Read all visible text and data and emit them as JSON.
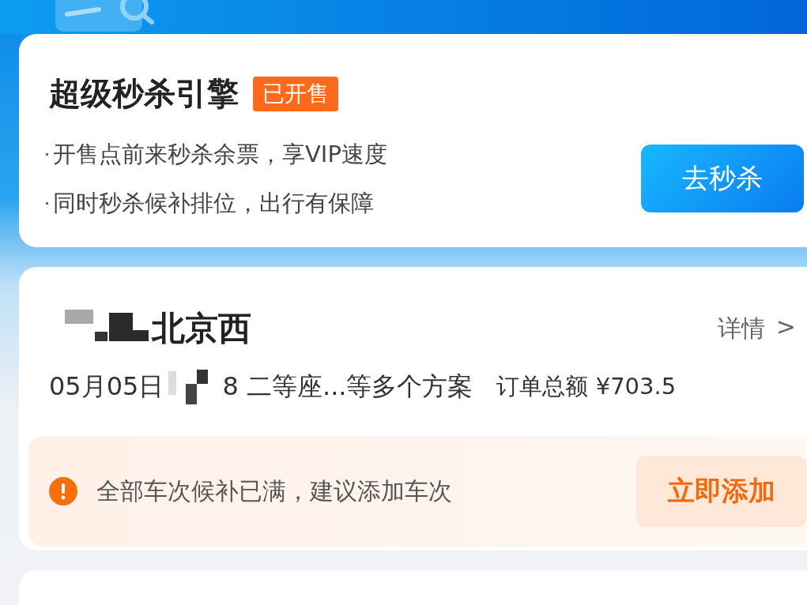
{
  "seckill_card": {
    "title": "超级秒杀引擎",
    "badge": "已开售",
    "points": [
      "开售点前来秒杀余票，享VIP速度",
      "同时秒杀候补排位，出行有保障"
    ],
    "button": "去秒杀"
  },
  "order_card": {
    "destination": "北京西",
    "details_link": "详情",
    "chevron": ">",
    "date": "05月05日",
    "plan_suffix": "8 二等座...等多个方案",
    "total_label": "订单总额 ¥703.5",
    "warning": {
      "text": "全部车次候补已满，建议添加车次",
      "button": "立即添加"
    }
  }
}
